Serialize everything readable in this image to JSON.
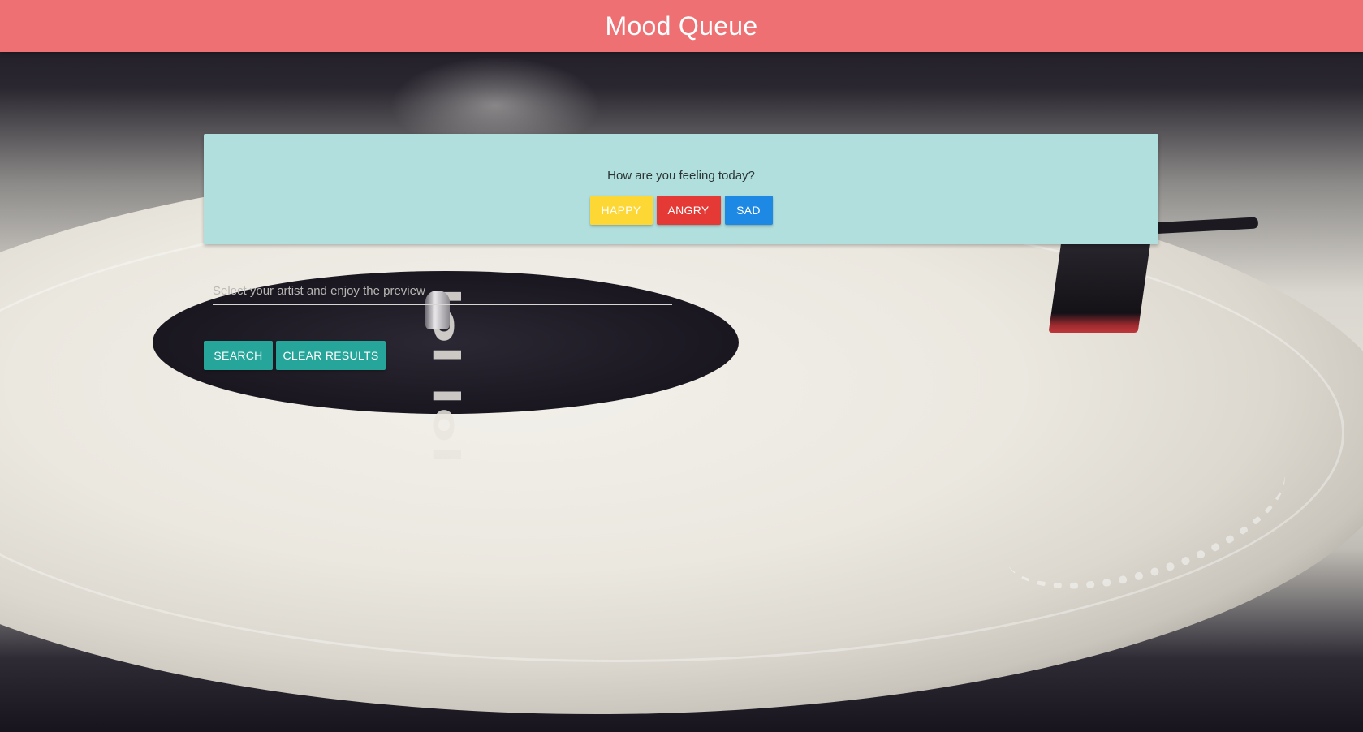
{
  "header": {
    "title": "Mood Queue"
  },
  "mood_card": {
    "question": "How are you feeling today?",
    "buttons": {
      "happy": "Happy",
      "angry": "Angry",
      "sad": "Sad"
    }
  },
  "search": {
    "placeholder": "Select your artist and enjoy the preview",
    "value": ""
  },
  "actions": {
    "search_label": "Search",
    "clear_label": "Clear Results"
  },
  "colors": {
    "header": "#ef7073",
    "card": "#b0dfdd",
    "happy": "#fdd835",
    "angry": "#e53935",
    "sad": "#1e88e5",
    "teal": "#26a69a"
  },
  "background": {
    "label_text": "lol lol"
  }
}
